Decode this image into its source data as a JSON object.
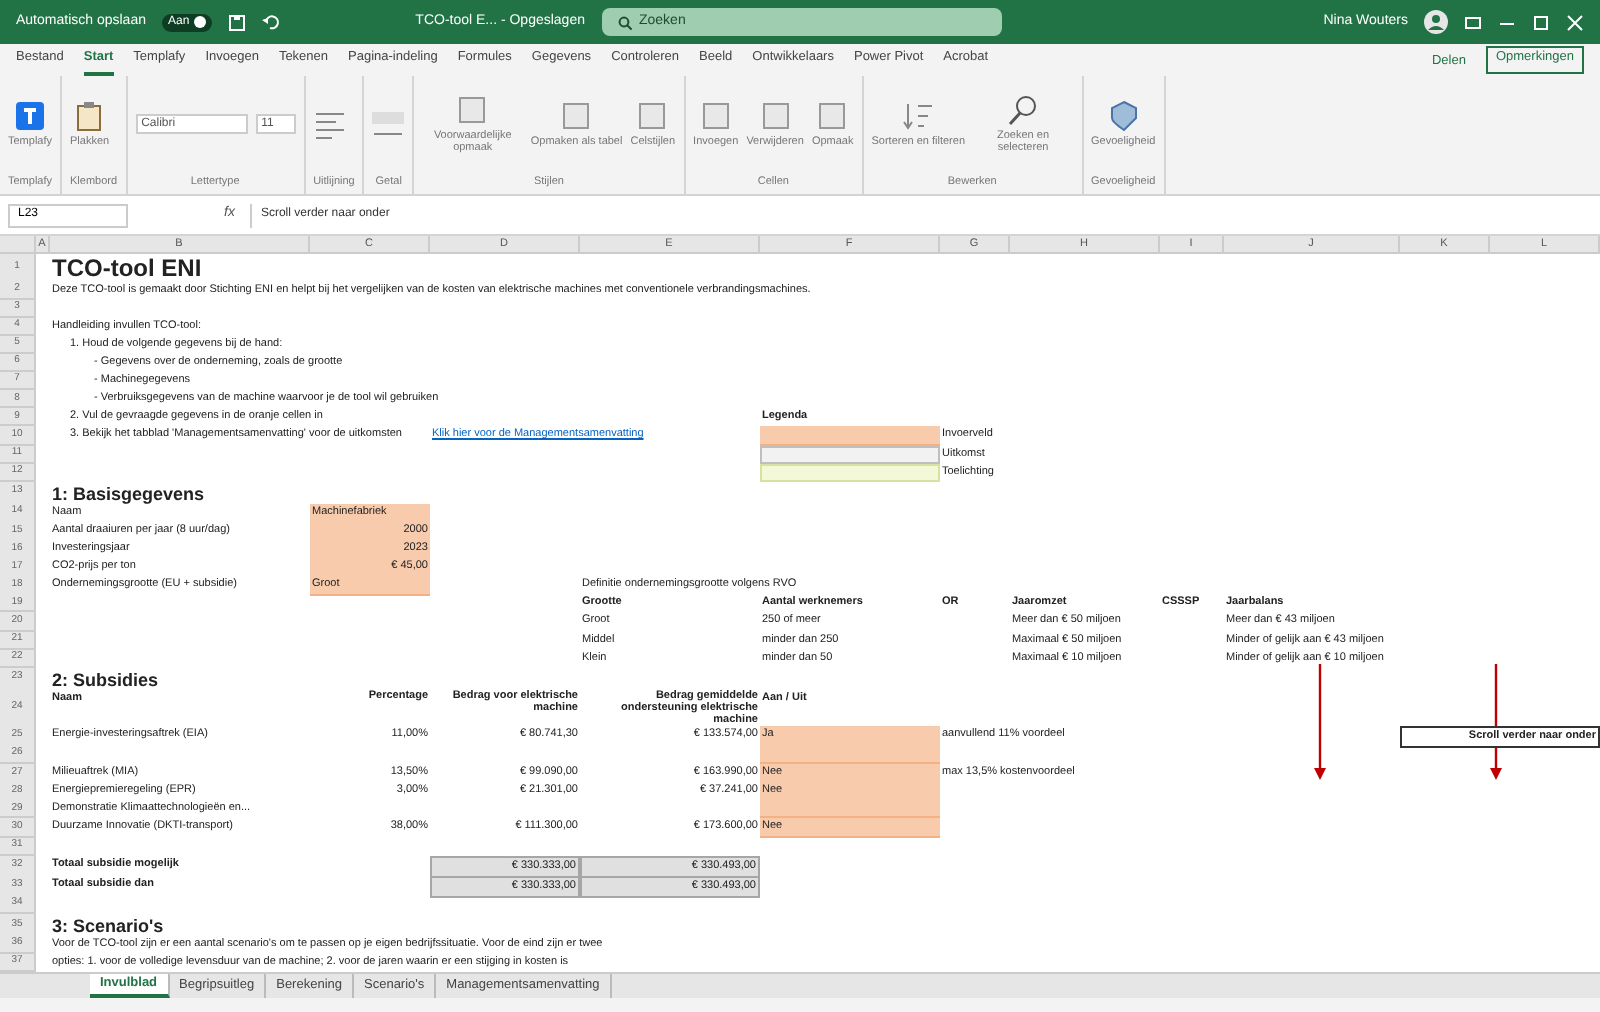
{
  "title_bar": {
    "autosave_label": "Automatisch opslaan",
    "autosave_on": true,
    "autosave_state": "Aan",
    "file": "TCO-tool E... - Opgeslagen",
    "search": "Zoeken",
    "user": "Nina Wouters"
  },
  "ribbon_tabs": [
    {
      "label": "Bestand",
      "selected": false
    },
    {
      "label": "Start",
      "selected": true
    },
    {
      "label": "Templafy",
      "selected": false
    },
    {
      "label": "Invoegen",
      "selected": false
    },
    {
      "label": "Tekenen",
      "selected": false
    },
    {
      "label": "Pagina-indeling",
      "selected": false
    },
    {
      "label": "Formules",
      "selected": false
    },
    {
      "label": "Gegevens",
      "selected": false
    },
    {
      "label": "Controleren",
      "selected": false
    },
    {
      "label": "Beeld",
      "selected": false
    },
    {
      "label": "Ontwikkelaars",
      "selected": false
    },
    {
      "label": "Power Pivot",
      "selected": false
    },
    {
      "label": "Acrobat",
      "selected": false
    }
  ],
  "share": "Delen",
  "comments": "Opmerkingen",
  "ribbon_groups": [
    {
      "label": "Templafy",
      "items": [
        {
          "kind": "button",
          "label": "Templafy"
        }
      ]
    },
    {
      "label": "Klembord",
      "items": [
        {
          "kind": "button",
          "label": "Plakken"
        }
      ]
    },
    {
      "label": "Lettertype",
      "items": [
        {
          "kind": "field",
          "label": "Calibri"
        },
        {
          "kind": "field",
          "label": "11"
        }
      ]
    },
    {
      "label": "Uitlijning",
      "items": [
        {
          "kind": "icon"
        }
      ]
    },
    {
      "label": "Getal",
      "items": [
        {
          "kind": "icon"
        }
      ]
    },
    {
      "label": "Stijlen",
      "items": [
        {
          "kind": "button",
          "label": "Voorwaardelijke opmaak"
        },
        {
          "kind": "button",
          "label": "Opmaken als tabel"
        },
        {
          "kind": "button",
          "label": "Celstijlen"
        }
      ]
    },
    {
      "label": "Cellen",
      "items": [
        {
          "kind": "button",
          "label": "Invoegen"
        },
        {
          "kind": "button",
          "label": "Verwijderen"
        },
        {
          "kind": "button",
          "label": "Opmaak"
        }
      ]
    },
    {
      "label": "Bewerken",
      "items": [
        {
          "kind": "button",
          "label": "Sorteren en filteren"
        },
        {
          "kind": "button",
          "label": "Zoeken en selecteren"
        }
      ]
    },
    {
      "label": "Gevoeligheid",
      "items": [
        {
          "kind": "button",
          "label": "Gevoeligheid"
        }
      ]
    }
  ],
  "formula_bar": {
    "name_box": "L23",
    "fx": "fx",
    "content": "Scroll verder naar onder"
  },
  "columns": [
    "A",
    "B",
    "C",
    "D",
    "E",
    "F",
    "G",
    "H",
    "I",
    "J",
    "K",
    "L"
  ],
  "rows": [
    {
      "number": "1",
      "cells": [
        null,
        {
          "kind": "title",
          "text": "TCO-tool ENI"
        }
      ]
    },
    {
      "number": "2",
      "cells": [
        null,
        {
          "kind": "text",
          "text": "Deze TCO-tool is gemaakt door Stichting ENI en helpt bij het vergelijken van de kosten van elektrische machines met conventionele verbrandingsmachines."
        }
      ]
    },
    {
      "number": "3",
      "cells": []
    },
    {
      "number": "4",
      "cells": [
        null,
        {
          "kind": "text",
          "text": "Handleiding invullen TCO-tool:"
        }
      ]
    },
    {
      "number": "5",
      "cells": [
        null,
        {
          "kind": "list",
          "text": "1.   Houd de volgende gegevens bij de hand:"
        }
      ]
    },
    {
      "number": "6",
      "cells": [
        null,
        {
          "kind": "sublist",
          "text": "- Gegevens over de onderneming, zoals de grootte"
        }
      ]
    },
    {
      "number": "7",
      "cells": [
        null,
        {
          "kind": "sublist",
          "text": "- Machinegegevens"
        }
      ]
    },
    {
      "number": "8",
      "cells": [
        null,
        {
          "kind": "sublist",
          "text": "- Verbruiksgegevens van de machine waarvoor je de tool wil gebruiken"
        }
      ]
    },
    {
      "number": "9",
      "cells": [
        null,
        {
          "kind": "list",
          "text": "2.   Vul de gevraagde gegevens in de oranje cellen in"
        },
        null,
        null,
        null,
        {
          "kind": "bold",
          "text": "Legenda"
        }
      ]
    },
    {
      "number": "10",
      "cells": [
        null,
        {
          "kind": "list",
          "text": "3.   Bekijk het tabblad 'Managementsamenvatting' voor de uitkomsten"
        },
        null,
        {
          "kind": "link",
          "text": "Klik hier voor de Managementsamenvatting"
        },
        null,
        {
          "kind": "input"
        },
        {
          "kind": "text",
          "text": "Invoerveld"
        }
      ]
    },
    {
      "number": "11",
      "cells": [
        null,
        null,
        null,
        null,
        null,
        {
          "kind": "output"
        },
        {
          "kind": "text",
          "text": "Uitkomst"
        }
      ]
    },
    {
      "number": "12",
      "cells": [
        null,
        null,
        null,
        null,
        null,
        {
          "kind": "note"
        },
        {
          "kind": "text",
          "text": "Toelichting"
        }
      ]
    },
    {
      "number": "13",
      "cells": [
        null,
        {
          "kind": "heading",
          "text": "1: Basisgegevens"
        }
      ]
    },
    {
      "number": "14",
      "cells": [
        null,
        {
          "kind": "text",
          "text": "Naam"
        },
        {
          "kind": "input",
          "text": "Machinefabriek"
        }
      ]
    },
    {
      "number": "15",
      "cells": [
        null,
        {
          "kind": "text",
          "text": "Aantal draaiuren per jaar (8 uur/dag)"
        },
        {
          "kind": "inputnum",
          "text": "2000"
        }
      ]
    },
    {
      "number": "16",
      "cells": [
        null,
        {
          "kind": "text",
          "text": "Investeringsjaar"
        },
        {
          "kind": "inputnum",
          "text": "2023"
        }
      ]
    },
    {
      "number": "17",
      "cells": [
        null,
        {
          "kind": "text",
          "text": "CO2-prijs per ton"
        },
        {
          "kind": "inputnum",
          "text": "€ 45,00"
        }
      ]
    },
    {
      "number": "18",
      "cells": [
        null,
        {
          "kind": "text",
          "text": "Ondernemingsgrootte (EU + subsidie)"
        },
        {
          "kind": "input",
          "text": "Groot"
        },
        null,
        {
          "kind": "text",
          "text": "Definitie ondernemingsgrootte volgens RVO"
        }
      ]
    },
    {
      "number": "19",
      "cells": [
        null,
        null,
        null,
        null,
        {
          "kind": "bold",
          "text": "Grootte"
        },
        {
          "kind": "bold",
          "text": "Aantal werknemers"
        },
        {
          "kind": "bold",
          "text": "OR"
        },
        {
          "kind": "bold",
          "text": "Jaaromzet"
        },
        {
          "kind": "bold",
          "text": "CSSSP"
        },
        {
          "kind": "bold",
          "text": "Jaarbalans"
        }
      ]
    },
    {
      "number": "20",
      "cells": [
        null,
        null,
        null,
        null,
        {
          "kind": "text",
          "text": "Groot"
        },
        {
          "kind": "text",
          "text": "250 of meer"
        },
        null,
        {
          "kind": "text",
          "text": "Meer dan € 50 miljoen"
        },
        null,
        {
          "kind": "text",
          "text": "Meer dan € 43 miljoen"
        }
      ]
    },
    {
      "number": "21",
      "cells": [
        null,
        null,
        null,
        null,
        {
          "kind": "text",
          "text": "Middel"
        },
        {
          "kind": "text",
          "text": "minder dan 250"
        },
        null,
        {
          "kind": "text",
          "text": "Maximaal € 50 miljoen"
        },
        null,
        {
          "kind": "text",
          "text": "Minder of gelijk aan € 43 miljoen"
        }
      ]
    },
    {
      "number": "22",
      "cells": [
        null,
        null,
        null,
        null,
        {
          "kind": "text",
          "text": "Klein"
        },
        {
          "kind": "text",
          "text": "minder dan 50"
        },
        null,
        {
          "kind": "text",
          "text": "Maximaal € 10 miljoen"
        },
        null,
        {
          "kind": "text",
          "text": "Minder of gelijk aan € 10 miljoen"
        }
      ]
    },
    {
      "number": "23",
      "cells": [
        null,
        {
          "kind": "heading",
          "text": "2: Subsidies"
        }
      ]
    },
    {
      "number": "24",
      "cells": [
        null,
        {
          "kind": "bold",
          "text": "Naam"
        },
        {
          "kind": "header",
          "text": "Percentage"
        },
        {
          "kind": "header",
          "text": "Bedrag voor elektrische machine"
        },
        {
          "kind": "header",
          "text": "Bedrag gemiddelde ondersteuning elektrische machine"
        },
        {
          "kind": "bold",
          "text": "Aan / Uit"
        }
      ]
    },
    {
      "number": "25",
      "cells": [
        null,
        {
          "kind": "text",
          "text": "Energie-investeringsaftrek (EIA)"
        },
        {
          "kind": "number",
          "text": "11,00%"
        },
        {
          "kind": "number",
          "text": "€ 80.741,30"
        },
        {
          "kind": "number",
          "text": "€ 133.574,00"
        },
        {
          "kind": "input",
          "text": "Ja"
        },
        {
          "kind": "text",
          "text": "aanvullend 11% voordeel"
        },
        null,
        null,
        null,
        {
          "kind": "boxed",
          "text": "Scroll verder naar onder"
        }
      ]
    },
    {
      "number": "26",
      "cells": [
        null,
        null,
        null,
        null,
        null,
        {
          "kind": "input"
        }
      ]
    },
    {
      "number": "27",
      "cells": [
        null,
        {
          "kind": "text",
          "text": "Milieuaftrek (MIA)"
        },
        {
          "kind": "number",
          "text": "13,50%"
        },
        {
          "kind": "number",
          "text": "€ 99.090,00"
        },
        {
          "kind": "number",
          "text": "€ 163.990,00"
        },
        {
          "kind": "input",
          "text": "Nee"
        },
        {
          "kind": "text",
          "text": "max 13,5% kostenvoordeel"
        }
      ]
    },
    {
      "number": "28",
      "cells": [
        null,
        {
          "kind": "text",
          "text": "Energiepremieregeling (EPR)"
        },
        {
          "kind": "number",
          "text": "3,00%"
        },
        {
          "kind": "number",
          "text": "€ 21.301,00"
        },
        {
          "kind": "number",
          "text": "€ 37.241,00"
        },
        {
          "kind": "input",
          "text": "Nee"
        }
      ]
    },
    {
      "number": "29",
      "cells": [
        null,
        {
          "kind": "text",
          "text": "Demonstratie Klimaattechnologieën en..."
        },
        null,
        null,
        null,
        {
          "kind": "input"
        }
      ]
    },
    {
      "number": "30",
      "cells": [
        null,
        {
          "kind": "text",
          "text": "Duurzame Innovatie (DKTI-transport)"
        },
        {
          "kind": "number",
          "text": "38,00%"
        },
        {
          "kind": "number",
          "text": "€ 111.300,00"
        },
        {
          "kind": "number",
          "text": "€ 173.600,00"
        },
        {
          "kind": "input",
          "text": "Nee"
        }
      ]
    },
    {
      "number": "31",
      "cells": []
    },
    {
      "number": "32",
      "cells": [
        null,
        {
          "kind": "bold",
          "text": "Totaal subsidie mogelijk"
        },
        null,
        {
          "kind": "total",
          "text": "€ 330.333,00"
        },
        {
          "kind": "total",
          "text": "€ 330.493,00"
        }
      ]
    },
    {
      "number": "33",
      "cells": [
        null,
        {
          "kind": "bold",
          "text": "Totaal subsidie dan"
        },
        null,
        {
          "kind": "total",
          "text": "€ 330.333,00"
        },
        {
          "kind": "total",
          "text": "€ 330.493,00"
        }
      ]
    },
    {
      "number": "34",
      "cells": []
    },
    {
      "number": "35",
      "cells": [
        null,
        {
          "kind": "heading",
          "text": "3: Scenario's"
        }
      ]
    },
    {
      "number": "36",
      "cells": [
        null,
        {
          "kind": "text",
          "text": "Voor de TCO-tool zijn er een aantal scenario's om te passen op je eigen bedrijfssituatie. Voor de eind zijn er twee"
        }
      ]
    },
    {
      "number": "37",
      "cells": [
        null,
        {
          "kind": "text",
          "text": "opties: 1. voor de volledige levensduur van de machine; 2. voor de jaren waarin er een stijging in kosten is"
        }
      ]
    }
  ],
  "sheet_tabs": [
    {
      "label": "Invulblad",
      "selected": true
    },
    {
      "label": "Begripsuitleg",
      "selected": false
    },
    {
      "label": "Berekening",
      "selected": false
    },
    {
      "label": "Scenario's",
      "selected": false
    },
    {
      "label": "Managementsamenvatting",
      "selected": false
    }
  ]
}
